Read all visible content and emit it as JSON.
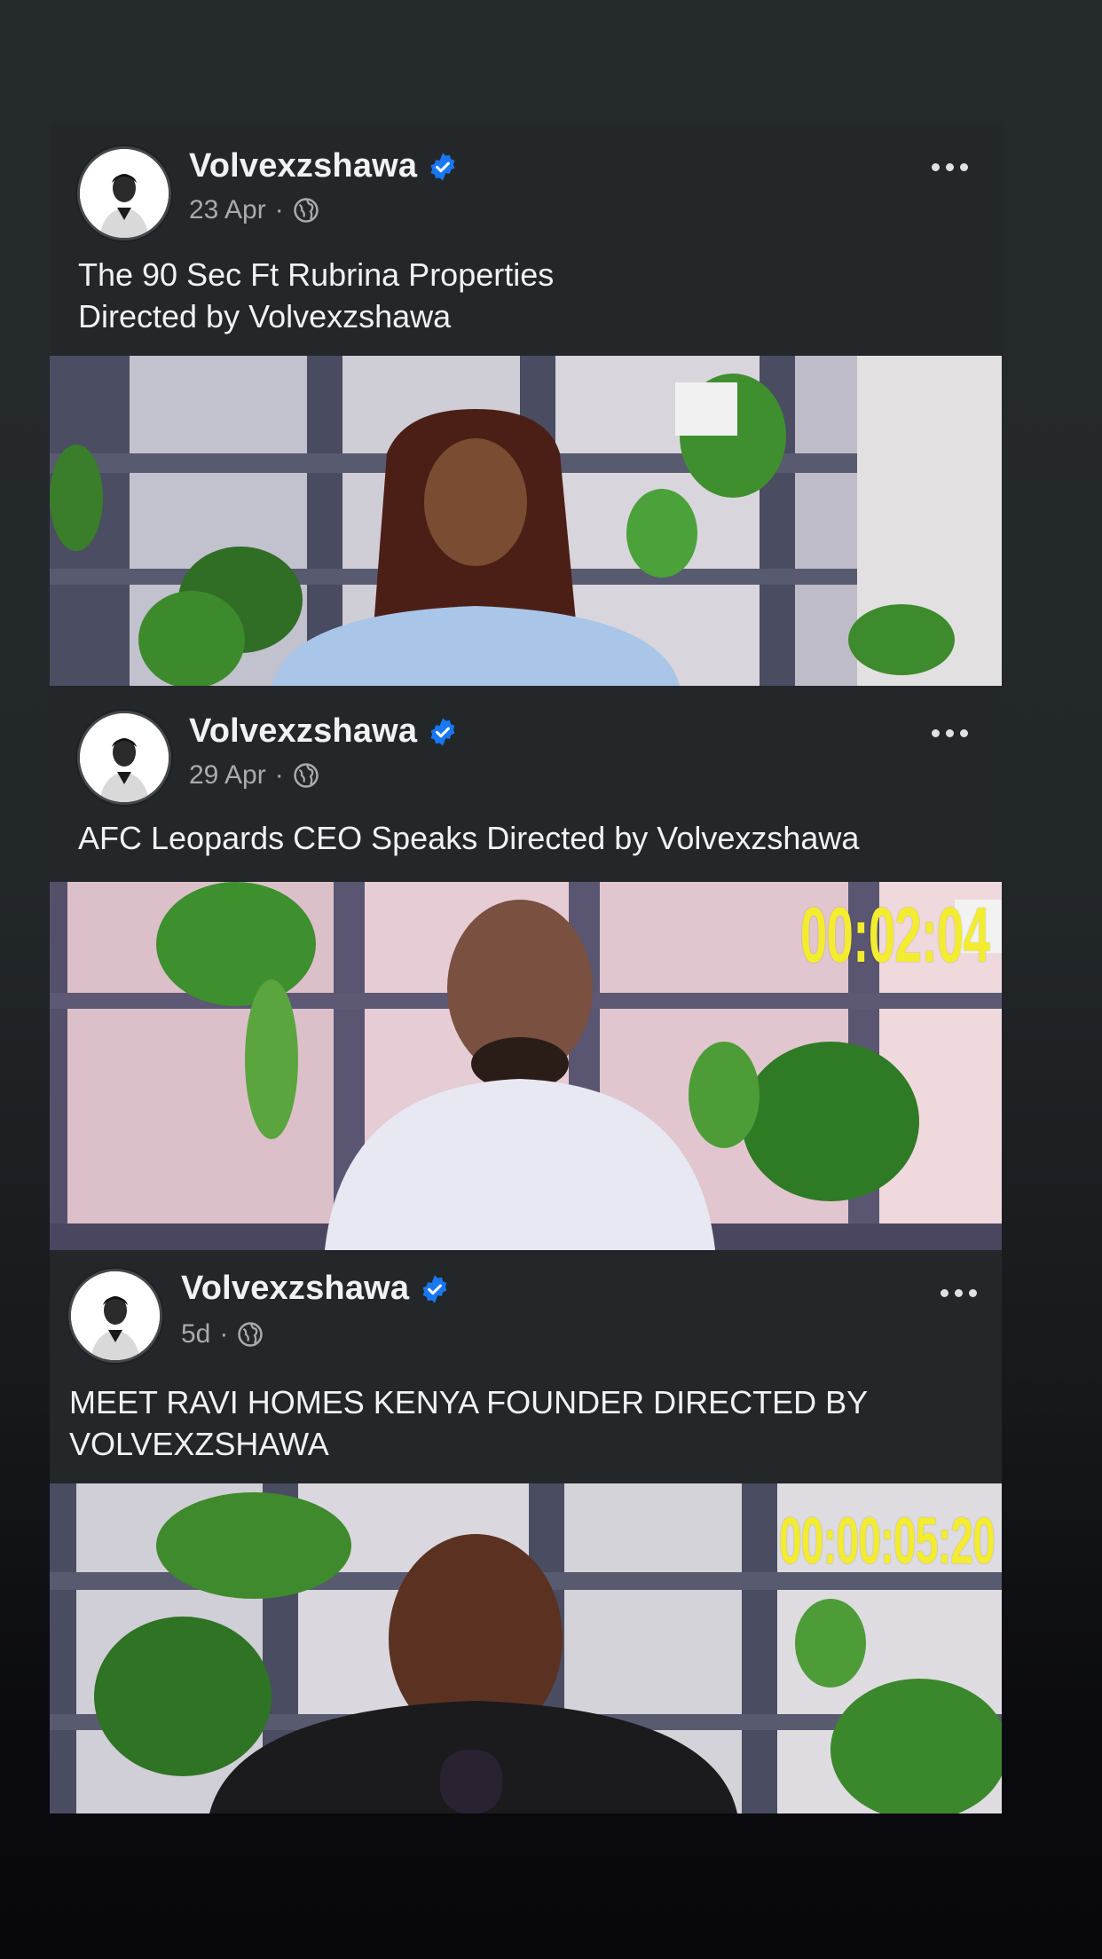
{
  "posts": [
    {
      "author": "Volvexzshawa",
      "date": "23 Apr",
      "separator": "·",
      "verified": true,
      "privacy_icon": "globe-icon",
      "caption": "The 90 Sec Ft Rubrina Properties\nDirected by Volvexzshawa",
      "timecode": ""
    },
    {
      "author": "Volvexzshawa",
      "date": "29 Apr",
      "separator": "·",
      "verified": true,
      "privacy_icon": "globe-icon",
      "caption": "AFC Leopards CEO Speaks Directed by Volvexzshawa",
      "timecode": "00:02:04"
    },
    {
      "author": "Volvexzshawa",
      "date": "5d",
      "separator": "·",
      "verified": true,
      "privacy_icon": "globe-icon",
      "caption": "MEET RAVI HOMES KENYA FOUNDER DIRECTED BY\nVOLVEXZSHAWA",
      "timecode": "00:00:05:20"
    }
  ],
  "colors": {
    "background": "#252a2c",
    "card": "#242729",
    "verified_badge": "#1877f2",
    "timecode": "#f3ec2f"
  }
}
